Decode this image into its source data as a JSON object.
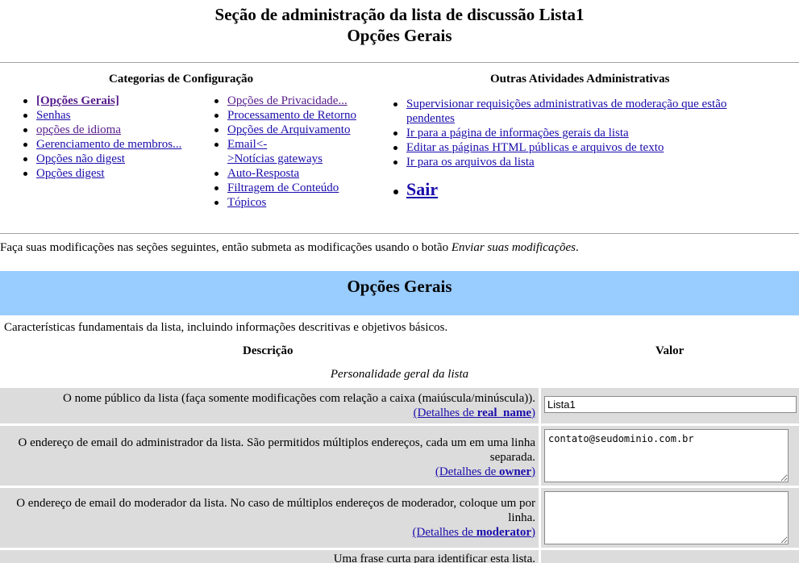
{
  "header": {
    "title_line1": "Seção de administração da lista de discussão Lista1",
    "title_line2": "Opções Gerais"
  },
  "config_categories": {
    "title": "Categorias de Configuração",
    "col1": [
      {
        "label": "[Opções Gerais]",
        "bold": true,
        "visited": true
      },
      {
        "label": "Senhas"
      },
      {
        "label": "opções de idioma",
        "visited": true
      },
      {
        "label": "Gerenciamento de membros..."
      },
      {
        "label": "Opções não digest"
      },
      {
        "label": "Opções digest"
      }
    ],
    "col2": [
      {
        "label": "Opções de Privacidade...",
        "visited": true
      },
      {
        "label": "Processamento de Retorno"
      },
      {
        "label": "Opções de Arquivamento"
      },
      {
        "label": "Email<-\n>Notícias gateways"
      },
      {
        "label": "Auto-Resposta"
      },
      {
        "label": "Filtragem de Conteúdo"
      },
      {
        "label": "Tópicos"
      }
    ]
  },
  "other_activities": {
    "title": "Outras Atividades Administrativas",
    "items": [
      "Supervisionar requisições administrativas de moderação que estão pendentes",
      "Ir para a página de informações gerais da lista",
      "Editar as páginas HTML públicas e arquivos de texto",
      "Ir para os arquivos da lista"
    ],
    "logout": "Sair"
  },
  "intro": {
    "text": "Faça suas modificações nas seções seguintes, então submeta as modificações usando o botão ",
    "button_ref": "Enviar suas modificações",
    "end": "."
  },
  "section": {
    "title": "Opções Gerais",
    "description": "Características fundamentais da lista, incluindo informações descritivas e objetivos básicos.",
    "col_description": "Descrição",
    "col_value": "Valor",
    "group": "Personalidade geral da lista"
  },
  "fields": {
    "real_name": {
      "desc": "O nome público da lista (faça somente modificações com relação a caixa (maiúscula/minúscula)).",
      "details_prefix": "(Detalhes de ",
      "details_key": "real_name",
      "details_suffix": ")",
      "value": "Lista1"
    },
    "owner": {
      "desc": "O endereço de email do administrador da lista. São permitidos múltiplos endereços, cada um em uma linha separada.",
      "details_prefix": "(Detalhes de ",
      "details_key": "owner",
      "details_suffix": ")",
      "value": "contato@seudominio.com.br"
    },
    "moderator": {
      "desc": "O endereço de email do moderador da lista. No caso de múltiplos endereços de moderador, coloque um por linha.",
      "details_prefix": "(Detalhes de ",
      "details_key": "moderator",
      "details_suffix": ")",
      "value": ""
    },
    "description": {
      "desc": "Uma frase curta para identificar esta lista."
    }
  }
}
